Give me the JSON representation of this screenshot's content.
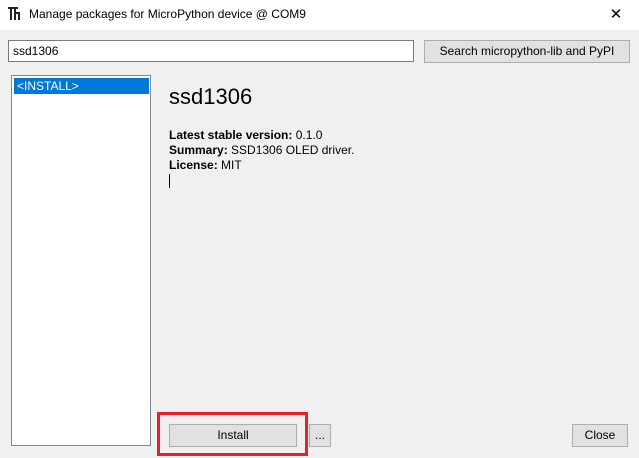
{
  "window": {
    "title": "Manage packages for MicroPython device @ COM9",
    "close_glyph": "✕"
  },
  "search": {
    "value": "ssd1306",
    "button_label": "Search micropython-lib and PyPI"
  },
  "package_list": {
    "items": [
      {
        "label": "<INSTALL>",
        "selected": true
      }
    ]
  },
  "details": {
    "package_name": "ssd1306",
    "version_label": "Latest stable version:",
    "version_value": "0.1.0",
    "summary_label": "Summary:",
    "summary_value": "SSD1306 OLED driver.",
    "license_label": "License:",
    "license_value": "MIT"
  },
  "footer": {
    "install_label": "Install",
    "more_label": "...",
    "close_label": "Close"
  },
  "colors": {
    "selection": "#0078d7",
    "highlight_box": "#e8202a"
  },
  "icons": {
    "app": "thonny-icon",
    "close": "close-icon"
  }
}
